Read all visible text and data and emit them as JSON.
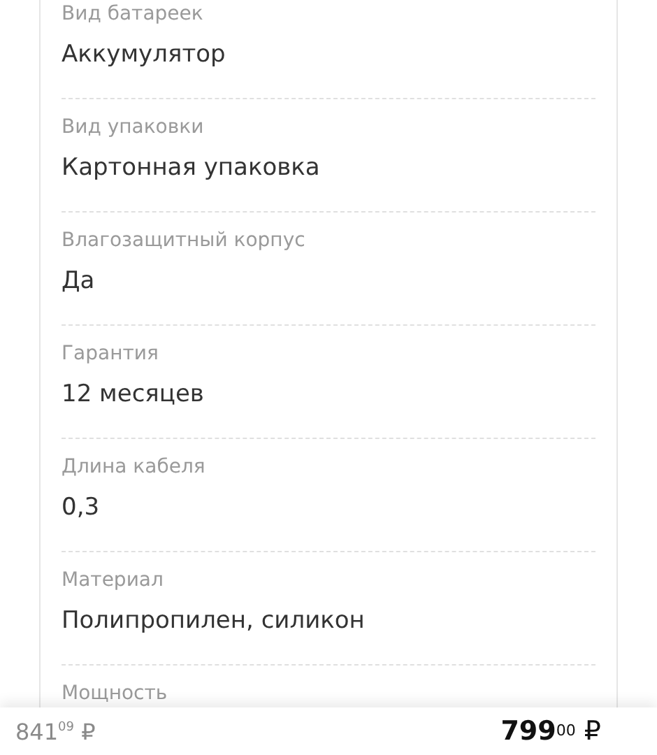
{
  "specs": [
    {
      "label": "Вид батареек",
      "value": "Аккумулятор"
    },
    {
      "label": "Вид упаковки",
      "value": "Картонная упаковка"
    },
    {
      "label": "Влагозащитный корпус",
      "value": "Да"
    },
    {
      "label": "Гарантия",
      "value": "12 месяцев"
    },
    {
      "label": "Длина кабеля",
      "value": "0,3"
    },
    {
      "label": "Материал",
      "value": "Полипропилен, силикон"
    },
    {
      "label": "Мощность"
    }
  ],
  "price_bar": {
    "old_price": "841$^{09}$ ₽",
    "price": "**799**$^{00}$ ₽"
  }
}
